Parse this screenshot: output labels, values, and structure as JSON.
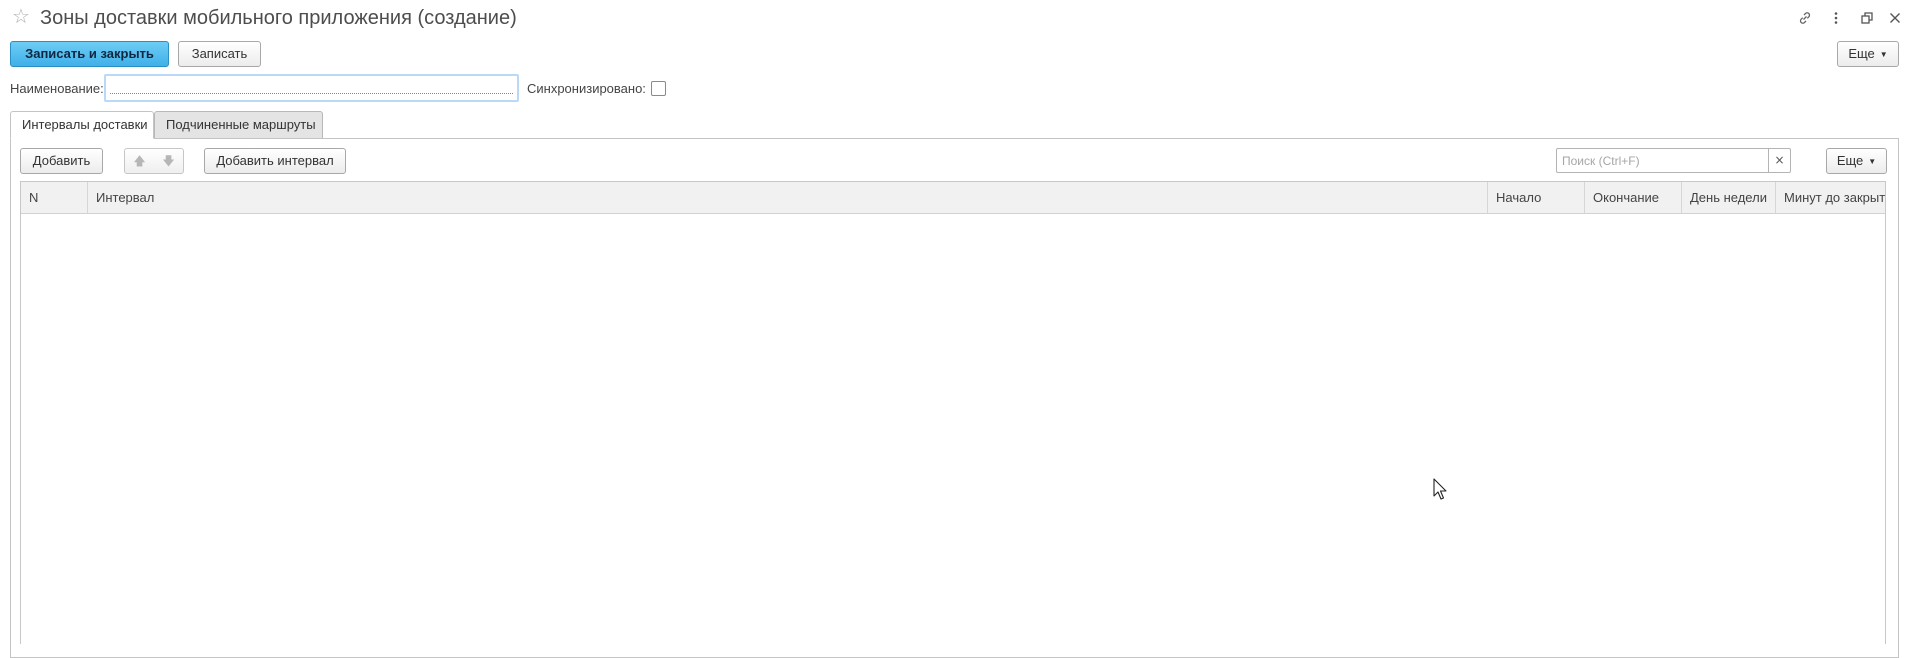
{
  "window": {
    "title": "Зоны доставки мобильного приложения (создание)"
  },
  "toolbar": {
    "save_close_label": "Записать и закрыть",
    "save_label": "Записать",
    "more_label": "Еще"
  },
  "form": {
    "name_label": "Наименование:",
    "name_value": "",
    "synced_label": "Синхронизировано:",
    "synced_checked": false
  },
  "tabs": [
    {
      "label": "Интервалы доставки",
      "active": true
    },
    {
      "label": "Подчиненные маршруты",
      "active": false
    }
  ],
  "table_toolbar": {
    "add_label": "Добавить",
    "add_interval_label": "Добавить интервал",
    "search_placeholder": "Поиск (Ctrl+F)",
    "search_value": "",
    "clear_symbol": "×",
    "more_label": "Еще"
  },
  "table": {
    "columns": [
      "N",
      "Интервал",
      "Начало",
      "Окончание",
      "День недели",
      "Минут до закрытия"
    ],
    "rows": []
  }
}
